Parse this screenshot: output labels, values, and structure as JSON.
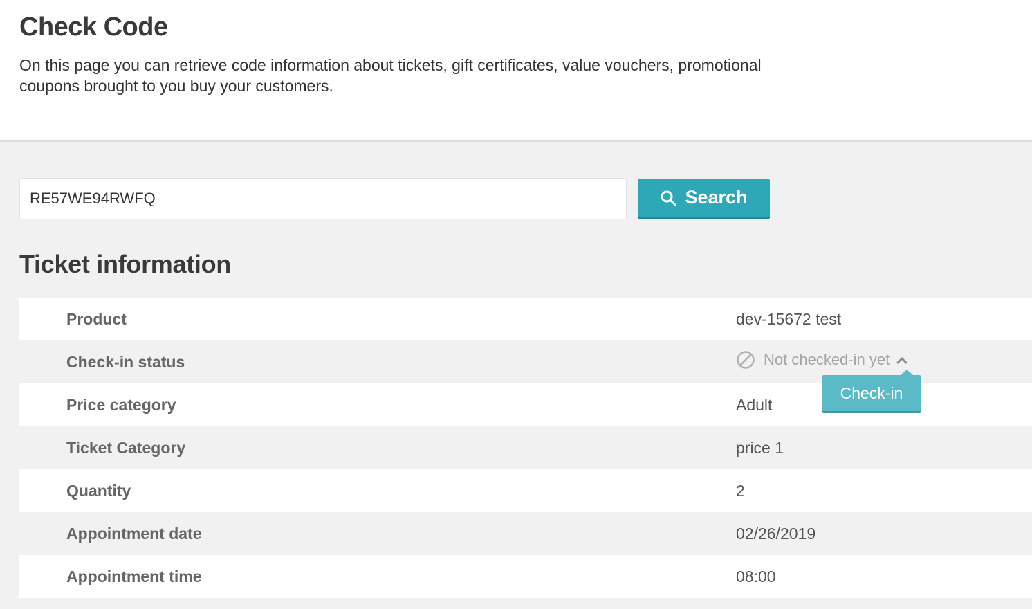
{
  "header": {
    "title": "Check Code",
    "description": "On this page you can retrieve code information about tickets, gift certificates, value vouchers, promotional coupons brought to you buy your customers."
  },
  "search": {
    "value": "RE57WE94RWFQ",
    "button_label": "Search",
    "button_icon": "search-icon"
  },
  "ticket": {
    "section_title": "Ticket information",
    "rows": [
      {
        "label": "Product",
        "value": "dev-15672 test"
      },
      {
        "label": "Check-in status",
        "value": "Not checked-in yet",
        "icon": "ban-icon"
      },
      {
        "label": "Price category",
        "value": "Adult"
      },
      {
        "label": "Ticket Category",
        "value": "price 1"
      },
      {
        "label": "Quantity",
        "value": "2"
      },
      {
        "label": "Appointment date",
        "value": "02/26/2019"
      },
      {
        "label": "Appointment time",
        "value": "08:00"
      }
    ],
    "checkin_button": "Check-in"
  },
  "colors": {
    "accent": "#2ea7b7",
    "popover": "#5bbac8",
    "status_gray": "#a5a5a5"
  }
}
